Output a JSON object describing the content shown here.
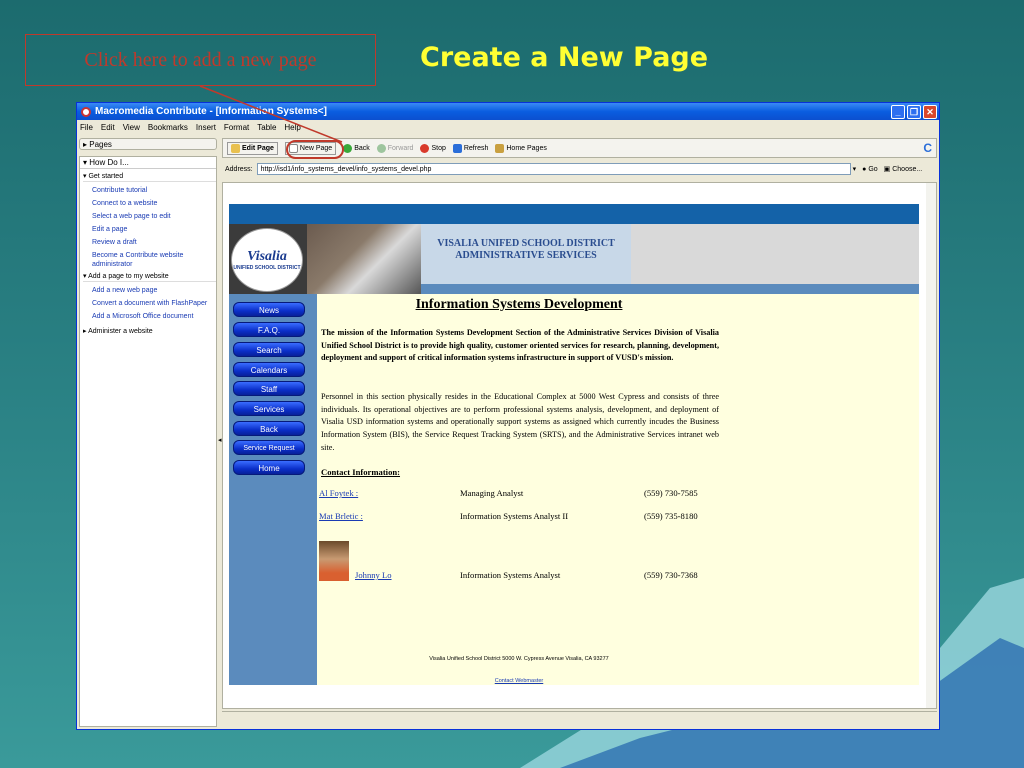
{
  "slide": {
    "callout": "Click here to add a new page",
    "title": "Create a New Page"
  },
  "window": {
    "title": "Macromedia Contribute - [Information Systems<]",
    "menu": [
      "File",
      "Edit",
      "View",
      "Bookmarks",
      "Insert",
      "Format",
      "Table",
      "Help"
    ]
  },
  "leftpanel": {
    "pages_label": "Pages",
    "howdoi_label": "How Do I...",
    "sections": [
      {
        "title": "Get started",
        "links": [
          "Contribute tutorial",
          "Connect to a website",
          "Select a web page to edit",
          "Edit a page",
          "Review a draft",
          "Become a Contribute website administrator"
        ]
      },
      {
        "title": "Add a page to my website",
        "links": [
          "Add a new web page",
          "Convert a document with FlashPaper",
          "Add a Microsoft Office document"
        ]
      },
      {
        "title": "Administer a website",
        "links": []
      }
    ]
  },
  "toolbar": {
    "edit_page": "Edit Page",
    "new_page": "New Page",
    "back": "Back",
    "forward": "Forward",
    "stop": "Stop",
    "refresh": "Refresh",
    "home_pages": "Home Pages"
  },
  "address": {
    "label": "Address:",
    "url": "http://isd1/info_systems_devel/info_systems_devel.php",
    "go": "Go",
    "choose": "Choose..."
  },
  "site": {
    "logo_big": "Visalia",
    "logo_small": "UNIFIED SCHOOL DISTRICT",
    "banner_line1": "VISALIA UNIFED SCHOOL DISTRICT",
    "banner_line2": "ADMINISTRATIVE SERVICES",
    "nav": [
      "News",
      "F.A.Q.",
      "Search",
      "Calendars",
      "Staff",
      "Services",
      "Back",
      "Service Request",
      "Home"
    ],
    "heading": "Information Systems Development",
    "mission": "The mission of the Information Systems Development Section of the Administrative Services Division of Visalia Unified School District is to provide high quality, customer oriented services for research, planning, development, deployment and support of critical information systems infrastructure in support of VUSD's mission.",
    "personnel": "Personnel in this section physically resides in the Educational Complex at 5000 West Cypress and consists of three individuals. Its operational objectives are to perform professional systems analysis, development, and deployment of Visalia USD information systems and operationally support systems as assigned which currently incudes the Business Information System (BIS), the Service Request Tracking System (SRTS), and the Administrative Services intranet web site.",
    "contact_title": "Contact Information:",
    "contacts": [
      {
        "name": "Al Foytek :",
        "role": "Managing Analyst",
        "phone": "(559) 730-7585"
      },
      {
        "name": "Mat Brletic :",
        "role": "Information Systems Analyst II",
        "phone": "(559) 735-8180"
      },
      {
        "name": "Johnny Lo",
        "role": "Information Systems Analyst",
        "phone": "(559) 730-7368"
      }
    ],
    "footer_address": "Visalia Unified School District 5000 W. Cypress Avenue Visalia, CA 93277",
    "footer_link": "Contact Webmaster"
  }
}
